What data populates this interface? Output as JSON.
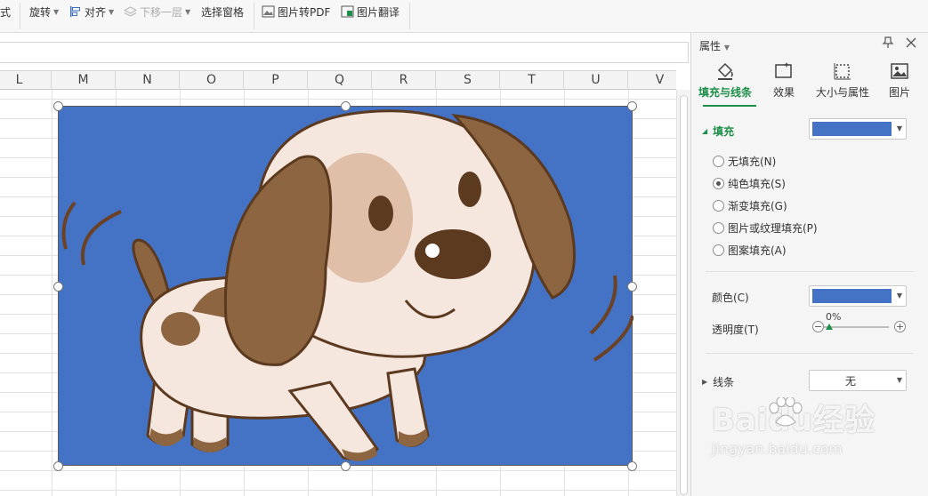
{
  "ribbon": {
    "partial_left": "式",
    "rotate": "旋转",
    "align": "对齐",
    "send_backward": "下移一层",
    "selection_pane": "选择窗格",
    "to_pdf": "图片转PDF",
    "translate": "图片翻译"
  },
  "columns": [
    "L",
    "M",
    "N",
    "O",
    "P",
    "Q",
    "R",
    "S",
    "T",
    "U",
    "V"
  ],
  "picture": {
    "fill_color": "#4472c4",
    "subject": "cartoon-puppy"
  },
  "pane": {
    "title": "属性",
    "tabs": [
      "填充与线条",
      "效果",
      "大小与属性",
      "图片"
    ],
    "fill_section": "填充",
    "fill_options": [
      "无填充(N)",
      "纯色填充(S)",
      "渐变填充(G)",
      "图片或纹理填充(P)",
      "图案填充(A)"
    ],
    "selected_fill_index": 1,
    "color_label": "颜色(C)",
    "transparency_label": "透明度(T)",
    "transparency_value": "0%",
    "line_section": "线条",
    "line_value": "无",
    "accent_color": "#1e8f4a",
    "swatch_color": "#4472c4"
  },
  "watermark": {
    "logo": "Baidu经验",
    "url": "jingyan.baidu.com"
  }
}
